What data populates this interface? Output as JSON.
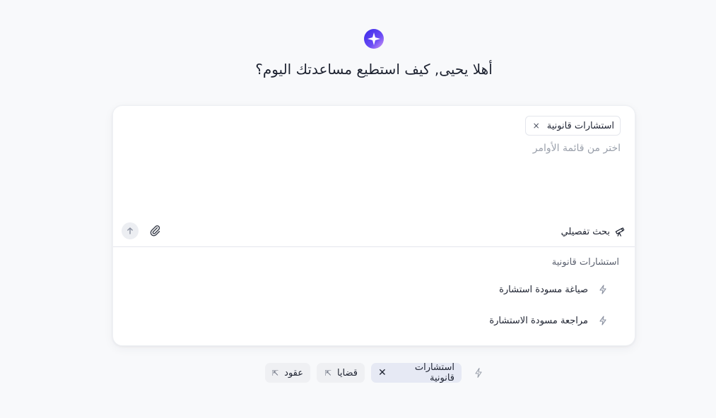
{
  "greeting": "أهلا يحيى, كيف استطيع مساعدتك اليوم؟",
  "composer": {
    "chip_label": "استشارات قانونية",
    "chip_remove": "×",
    "placeholder": "اختر من قائمة الأوامر",
    "deep_search_label": "بحث تفصيلي"
  },
  "command_menu": {
    "section_title": "استشارات قانونية",
    "items": [
      {
        "label": "صياغة مسودة استشارة",
        "icon": "bolt-icon"
      },
      {
        "label": "مراجعة مسودة الاستشارة",
        "icon": "bolt-icon"
      }
    ]
  },
  "quick_pills": [
    {
      "label": "استشارات قانونية",
      "state": "selected",
      "action": "✕"
    },
    {
      "label": "قضايا",
      "action": "⇱"
    },
    {
      "label": "عقود",
      "action": "⇱"
    }
  ],
  "colors": {
    "background": "#f8f9fb",
    "card": "#ffffff",
    "accent_start": "#4a3df0",
    "accent_end": "#c26cf2",
    "text": "#1d2230",
    "muted": "#9aa0ab"
  }
}
